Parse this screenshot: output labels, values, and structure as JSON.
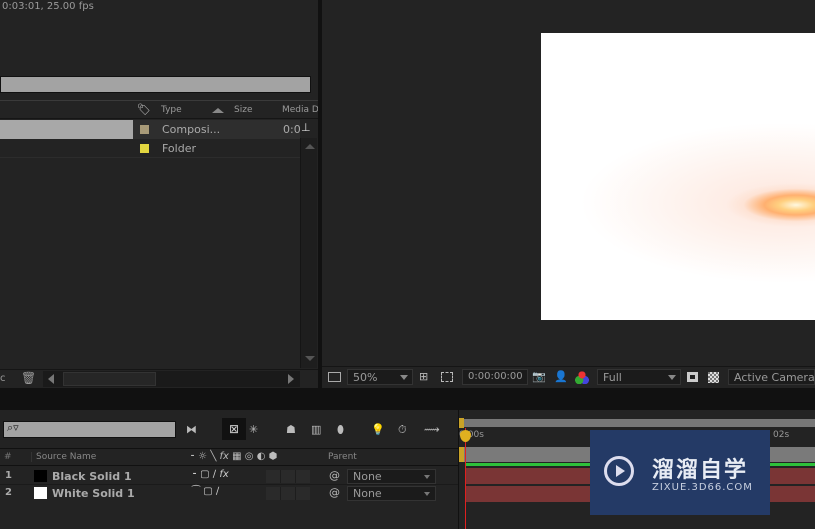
{
  "project": {
    "comp_info": "0:03:01, 25.00 fps",
    "columns": {
      "type": "Type",
      "size": "Size",
      "media": "Media D"
    },
    "items": [
      {
        "type": "Composi...",
        "duration": "0:0",
        "color": "#a89a78"
      },
      {
        "type": "Folder",
        "color": "#e2d640"
      }
    ],
    "bottom_label": "c"
  },
  "viewer": {
    "zoom": "50%",
    "timecode": "0:00:00:00",
    "resolution": "Full",
    "view": "Active Camera"
  },
  "timeline": {
    "columns": {
      "num": "#",
      "source": "Source Name",
      "parent": "Parent"
    },
    "layers": [
      {
        "num": "1",
        "name": "Black Solid 1",
        "swatch": "#000000",
        "parent": "None",
        "has_fx": true,
        "fx": "fx"
      },
      {
        "num": "2",
        "name": "White Solid 1",
        "swatch": "#ffffff",
        "parent": "None",
        "has_fx": false
      }
    ],
    "switch_header_fx": "fx",
    "ruler": {
      "start": "0:00s",
      "mark": "02s"
    }
  },
  "watermark": {
    "title": "溜溜自学",
    "url": "ZIXUE.3D66.COM"
  }
}
